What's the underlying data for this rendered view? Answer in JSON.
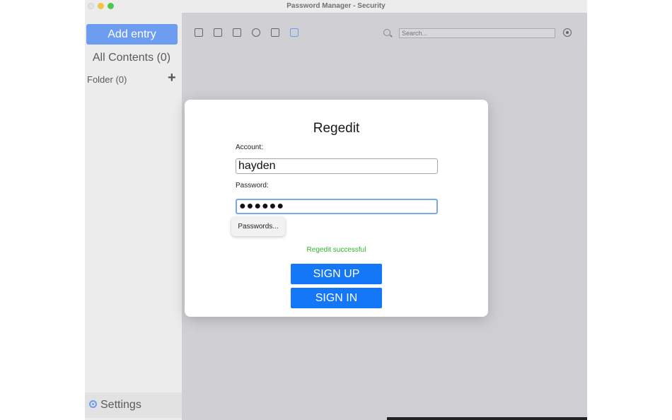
{
  "window": {
    "title": "Password Manager - Security"
  },
  "sidebar": {
    "add_entry_label": "Add entry",
    "all_contents_label": "All Contents (0)",
    "folder_label": "Folder  (0)",
    "folder_add_symbol": "+",
    "settings_label": "Settings"
  },
  "toolbar": {
    "icons": [
      "card-icon",
      "contact-icon",
      "copy-icon",
      "globe-icon",
      "note-icon",
      "security-icon"
    ],
    "search_placeholder": "Search..."
  },
  "dialog": {
    "title": "Regedit",
    "account_label": "Account:",
    "account_value": "hayden",
    "password_label": "Password:",
    "password_value": "●●●●●●",
    "autofill_menu_label": "Passwords...",
    "status_text": "Regedit successful",
    "signup_label": "SIGN UP",
    "signin_label": "SIGN IN"
  },
  "colors": {
    "accent": "#6d9df1",
    "primary_button": "#1477f7",
    "success": "#2fb52f"
  }
}
